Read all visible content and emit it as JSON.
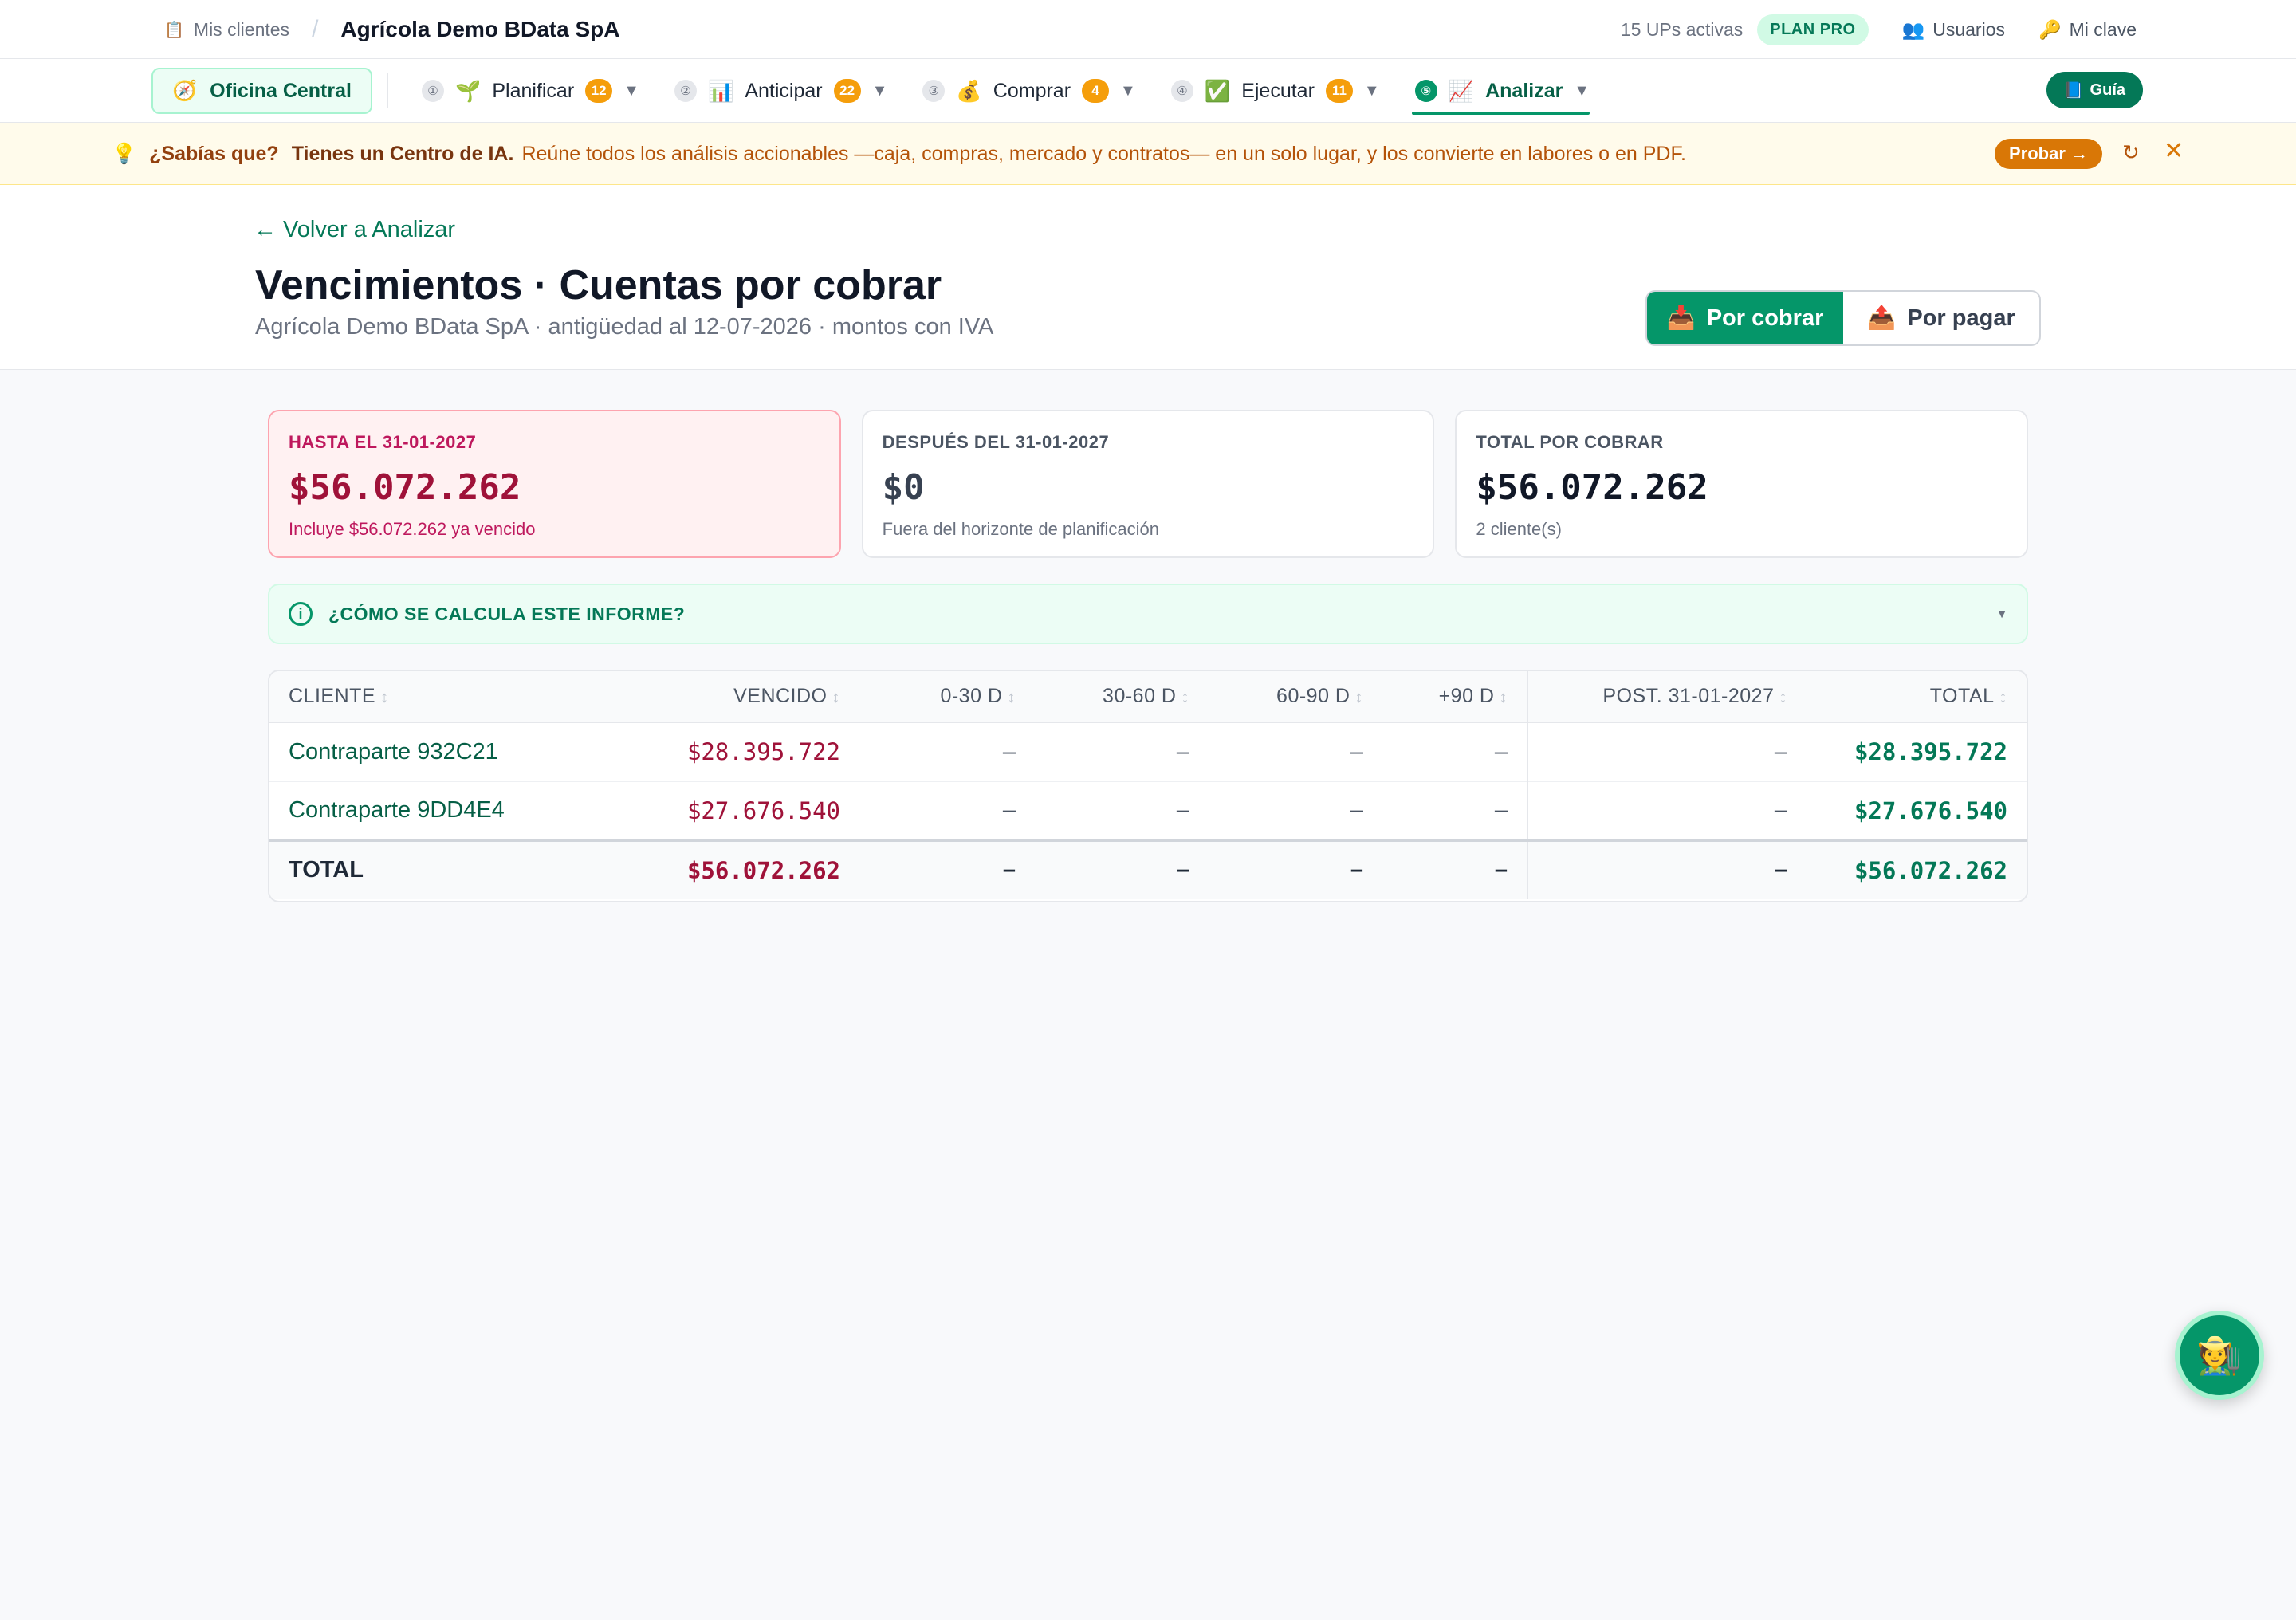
{
  "topbar": {
    "breadcrumb_icon": "clipboard-icon",
    "breadcrumb_label": "Mis clientes",
    "separator": "/",
    "client_name": "Agrícola Demo BData SpA",
    "active_units": "15 UPs activas",
    "plan_badge": "PLAN PRO",
    "users_label": "Usuarios",
    "password_label": "Mi clave"
  },
  "nav": {
    "office_label": "Oficina Central",
    "items": [
      {
        "step": "①",
        "icon": "🌱",
        "label": "Planificar",
        "count": "12"
      },
      {
        "step": "②",
        "icon": "📊",
        "label": "Anticipar",
        "count": "22"
      },
      {
        "step": "③",
        "icon": "💰",
        "label": "Comprar",
        "count": "4"
      },
      {
        "step": "④",
        "icon": "✅",
        "label": "Ejecutar",
        "count": "11"
      },
      {
        "step": "⑤",
        "icon": "📈",
        "label": "Analizar"
      }
    ],
    "guide_label": "Guía"
  },
  "banner": {
    "lead": "¿Sabías que?",
    "headline": "Tienes un Centro de IA.",
    "body": "Reúne todos los análisis accionables —caja, compras, mercado y contratos— en un solo lugar, y los convierte en labores o en PDF.",
    "try_label": "Probar →"
  },
  "header": {
    "back_label": "← Volver a Analizar",
    "title": "Vencimientos · Cuentas por cobrar",
    "subtitle": "Agrícola Demo BData SpA · antigüedad al 12-07-2026 · montos con IVA",
    "toggle": {
      "receivable": "Por cobrar",
      "payable": "Por pagar"
    }
  },
  "cards": [
    {
      "label": "HASTA EL 31-01-2027",
      "value": "$56.072.262",
      "note": "Incluye $56.072.262 ya vencido"
    },
    {
      "label": "DESPUÉS DEL 31-01-2027",
      "value": "$0",
      "note": "Fuera del horizonte de planificación"
    },
    {
      "label": "TOTAL POR COBRAR",
      "value": "$56.072.262",
      "note": "2 cliente(s)"
    }
  ],
  "info": {
    "label": "¿CÓMO SE CALCULA ESTE INFORME?"
  },
  "table": {
    "columns": [
      "CLIENTE",
      "VENCIDO",
      "0-30 D",
      "30-60 D",
      "60-90 D",
      "+90 D",
      "POST. 31-01-2027",
      "TOTAL"
    ],
    "rows": [
      {
        "client": "Contraparte 932C21",
        "overdue": "$28.395.722",
        "d0_30": "–",
        "d30_60": "–",
        "d60_90": "–",
        "d90": "–",
        "post": "–",
        "total": "$28.395.722"
      },
      {
        "client": "Contraparte 9DD4E4",
        "overdue": "$27.676.540",
        "d0_30": "–",
        "d30_60": "–",
        "d60_90": "–",
        "d90": "–",
        "post": "–",
        "total": "$27.676.540"
      }
    ],
    "total_row": {
      "client": "TOTAL",
      "overdue": "$56.072.262",
      "d0_30": "–",
      "d30_60": "–",
      "d60_90": "–",
      "d90": "–",
      "post": "–",
      "total": "$56.072.262"
    }
  },
  "colors": {
    "accent": "#059669",
    "overdue": "#9f1239",
    "warning": "#d97706"
  }
}
